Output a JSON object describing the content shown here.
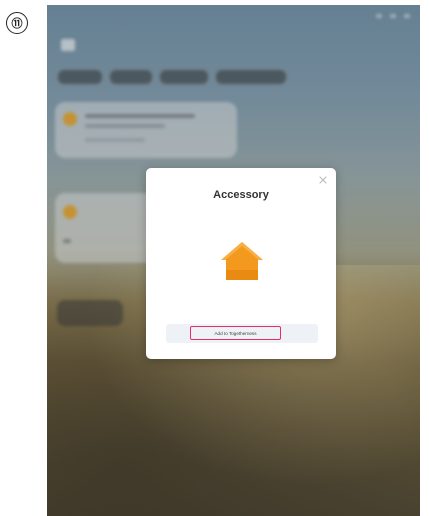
{
  "step": {
    "number": "⑪"
  },
  "modal": {
    "title": "Accessory",
    "add_button_label": "Add to Togetherness",
    "close_icon": "close-icon",
    "accessory_icon": "house-icon"
  },
  "colors": {
    "accessory_orange": "#f39a1e",
    "highlight_pink": "#e0306a",
    "card_dot": "#e8a52a"
  }
}
